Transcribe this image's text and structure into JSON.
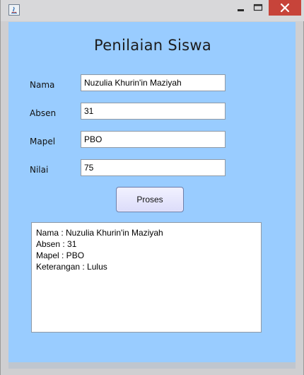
{
  "window": {
    "title": "",
    "icon": "java-app-icon"
  },
  "form": {
    "title": "Penilaian Siswa",
    "fields": [
      {
        "label": "Nama",
        "value": "Nuzulia Khurin'in Maziyah"
      },
      {
        "label": "Absen",
        "value": "31"
      },
      {
        "label": "Mapel",
        "value": "PBO"
      },
      {
        "label": "Nilai",
        "value": "75"
      }
    ],
    "button_label": "Proses",
    "output_lines": [
      "Nama : Nuzulia Khurin'in Maziyah",
      "Absen : 31",
      "Mapel : PBO",
      "Keterangan : Lulus"
    ]
  },
  "colors": {
    "client_bg": "#99ccff",
    "close_button": "#c7443a"
  }
}
